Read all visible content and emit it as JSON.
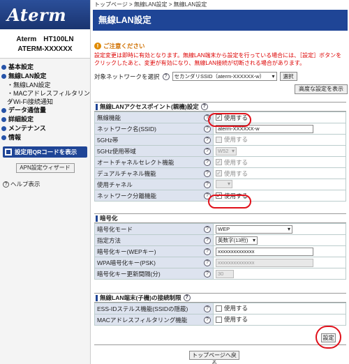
{
  "sidebar": {
    "logo": "Aterm",
    "model_line1": "Aterm　HT100LN",
    "model_line2": "ATERM-XXXXXX",
    "nav": [
      {
        "label": "基本設定"
      },
      {
        "label": "無線LAN設定"
      },
      {
        "sub": "・無線LAN設定"
      },
      {
        "sub": "・MACアドレスフィルタリング"
      },
      {
        "sub": "・Wi-Fi接続通知"
      },
      {
        "label": "データ通信量"
      },
      {
        "label": "詳細設定"
      },
      {
        "label": "メンテナンス"
      },
      {
        "label": "情報"
      }
    ],
    "qr_button": "設定用QRコードを表示",
    "apn_button": "APN設定ウィザード",
    "help": "ヘルプ表示"
  },
  "main": {
    "breadcrumb": "トップページ > 無線LAN設定 > 無線LAN設定",
    "title": "無線LAN設定",
    "notice_title": "ご注意ください",
    "notice_body": "設定変更は即時に有効となります。無線LAN端末から設定を行っている場合には、［設定］ボタンをクリックしたあと、変更が有効になり、無線LAN接続が切断される場合があります。",
    "target_label": "対象ネットワークを選択",
    "target_value": "セカンダリSSID（aterm-XXXXXX-w）",
    "select_button": "選択",
    "advanced_button": "高度な設定を表示",
    "sections": {
      "ap": {
        "title": "無線LANアクセスポイント(親機)設定",
        "rows": {
          "enable": {
            "label": "無線機能",
            "value": "使用する",
            "checked": true
          },
          "ssid": {
            "label": "ネットワーク名(SSID)",
            "value": "aterm-XXXXXX-w"
          },
          "band5": {
            "label": "5GHz帯",
            "value": "使用する"
          },
          "band5use": {
            "label": "5GHz使用帯域",
            "value": "W52"
          },
          "autoch": {
            "label": "オートチャネルセレクト機能",
            "value": "使用する"
          },
          "dualch": {
            "label": "デュアルチャネル機能",
            "value": "使用する"
          },
          "channel": {
            "label": "使用チャネル",
            "value": ""
          },
          "separate": {
            "label": "ネットワーク分離機能",
            "value": "使用する",
            "checked": true
          }
        }
      },
      "enc": {
        "title": "暗号化",
        "rows": {
          "mode": {
            "label": "暗号化モード",
            "value": "WEP"
          },
          "method": {
            "label": "指定方法",
            "value": "英数字(13桁)"
          },
          "wepkey": {
            "label": "暗号化キー(WEPキー)",
            "value": "xxxxxxxxxxxxxx"
          },
          "psk": {
            "label": "WPA暗号化キー(PSK)",
            "value": "xxxxxxxxxxxxxx"
          },
          "interval": {
            "label": "暗号化キー更新間隔(分)",
            "value": "30"
          }
        }
      },
      "restrict": {
        "title": "無線LAN端末(子機)の接続制限",
        "rows": {
          "stealth": {
            "label": "ESS-IDステルス機能(SSIDの隠蔽)",
            "value": "使用する"
          },
          "macfilter": {
            "label": "MACアドレスフィルタリング機能",
            "value": "使用する"
          }
        }
      }
    },
    "settings_button": "設定",
    "back_button": "トップページへ戻る"
  },
  "colors": {
    "accent": "#1f4596",
    "notice": "#d00000",
    "highlight_ring": "#e0101a"
  }
}
